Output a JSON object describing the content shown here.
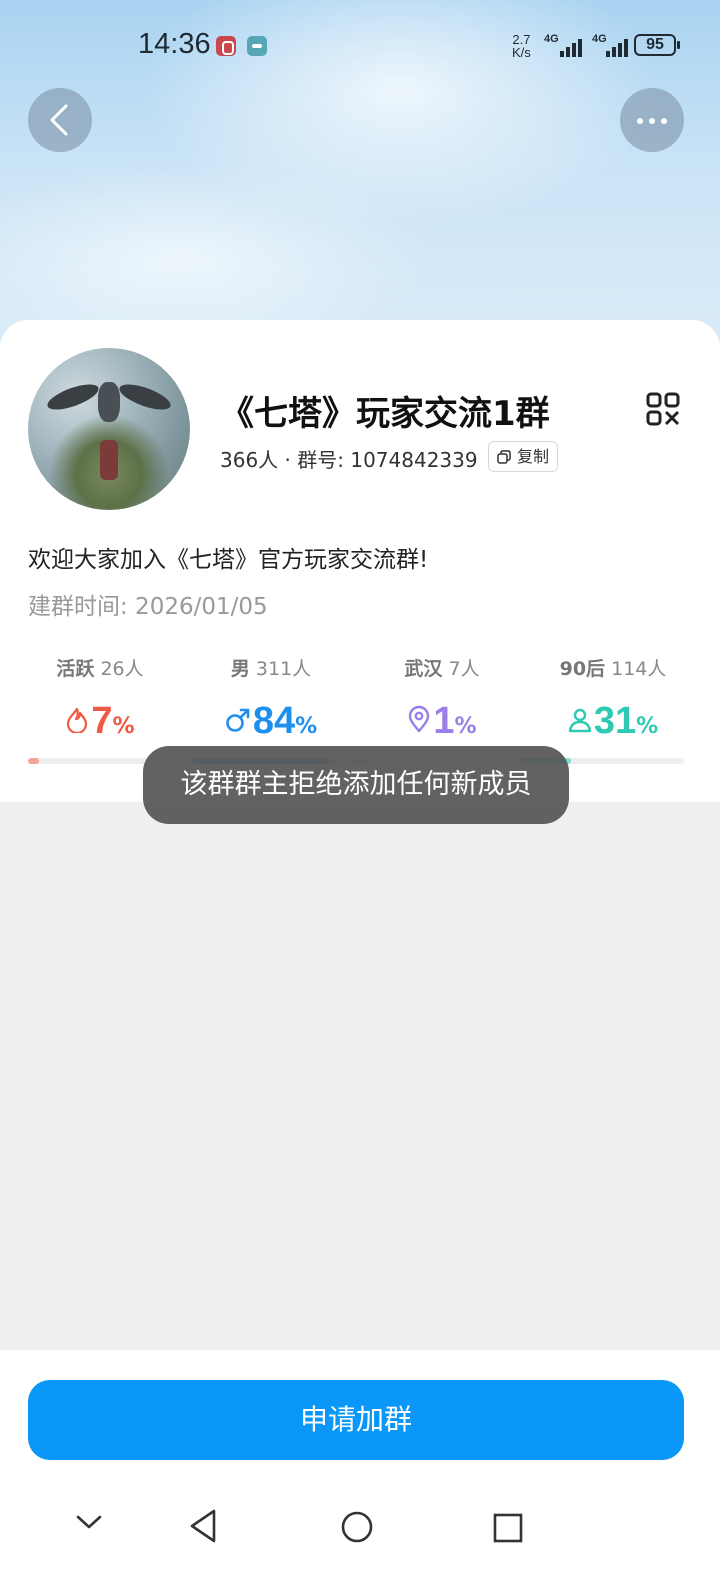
{
  "status_bar": {
    "time": "14:36",
    "net_speed_value": "2.7",
    "net_speed_unit": "K/s",
    "signal1_label": "4G",
    "signal2_label": "4G",
    "battery": "95"
  },
  "group": {
    "name": "《七塔》玩家交流1群",
    "meta": "366人 · 群号:  1074842339",
    "copy_label": "复制",
    "description": "欢迎大家加入《七塔》官方玩家交流群!",
    "created": "建群时间:  2026/01/05"
  },
  "stats": [
    {
      "label": "活跃",
      "count": "26人",
      "value": "7",
      "unit": "%",
      "color": "#f05a44",
      "icon": "flame-icon"
    },
    {
      "label": "男",
      "count": "311人",
      "value": "84",
      "unit": "%",
      "color": "#1e8ff0",
      "icon": "male-icon"
    },
    {
      "label": "武汉",
      "count": "7人",
      "value": "1",
      "unit": "%",
      "color": "#9a7fe8",
      "icon": "location-pin-icon"
    },
    {
      "label": "90后",
      "count": "114人",
      "value": "31",
      "unit": "%",
      "color": "#2ec9b3",
      "icon": "person-icon"
    }
  ],
  "progress": [
    {
      "name": "活跃",
      "fraction": 0.07,
      "color": "#f4a59a"
    },
    {
      "name": "男",
      "fraction": 0.84,
      "color": "#7ec0f6"
    },
    {
      "name": "武汉",
      "fraction": 0.01,
      "color": "#c9b9f2"
    },
    {
      "name": "90后",
      "fraction": 0.31,
      "color": "#7ee0d2"
    }
  ],
  "toast": "该群群主拒绝添加任何新成员",
  "join_button": "申请加群"
}
